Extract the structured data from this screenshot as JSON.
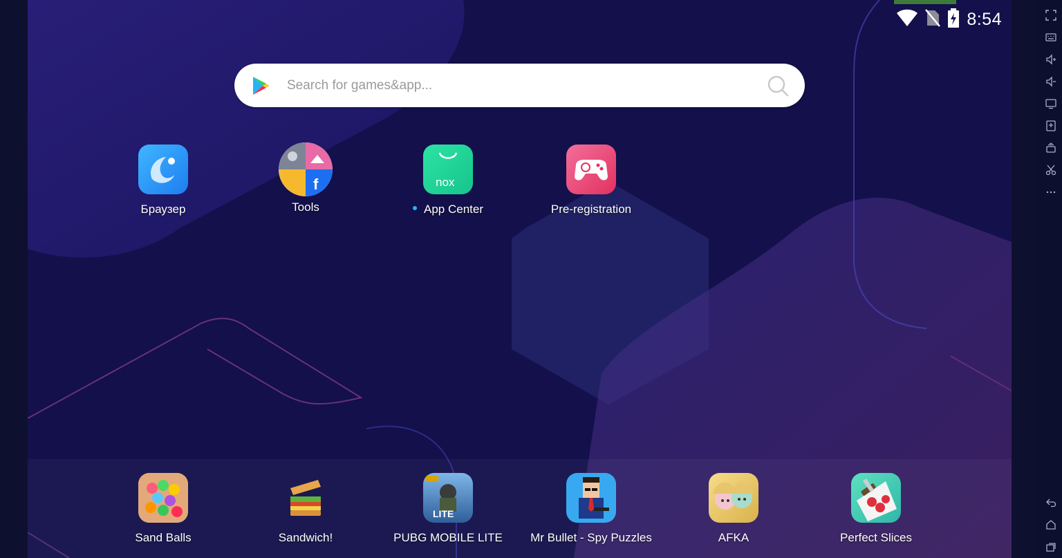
{
  "status_bar": {
    "time": "8:54",
    "icons": [
      "wifi-icon",
      "no-sim-icon",
      "battery-charging-icon"
    ]
  },
  "search": {
    "placeholder": "Search for games&app...",
    "value": ""
  },
  "home_apps": [
    {
      "label": "Браузер",
      "icon": "browser-icon"
    },
    {
      "label": "Tools",
      "icon": "tools-folder-icon"
    },
    {
      "label": "App Center",
      "icon": "nox-app-center-icon",
      "has_new_dot": true
    },
    {
      "label": "Pre-registration",
      "icon": "gamepad-icon"
    }
  ],
  "dock_apps": [
    {
      "label": "Sand Balls",
      "icon": "sand-balls-icon"
    },
    {
      "label": "Sandwich!",
      "icon": "sandwich-icon"
    },
    {
      "label": "PUBG MOBILE LITE",
      "icon": "pubg-lite-icon"
    },
    {
      "label": "Mr Bullet - Spy Puzzles",
      "icon": "mr-bullet-icon"
    },
    {
      "label": "AFKA",
      "icon": "afka-icon"
    },
    {
      "label": "Perfect Slices",
      "icon": "perfect-slices-icon"
    }
  ],
  "side_toolbar": [
    "fullscreen-icon",
    "keyboard-icon",
    "volume-up-icon",
    "volume-down-icon",
    "screen-icon",
    "add-apk-icon",
    "multi-instance-icon",
    "screenshot-cut-icon",
    "more-icon"
  ],
  "nav_buttons": [
    "back-icon",
    "home-icon",
    "recents-icon"
  ],
  "colors": {
    "wallpaper": "#12104a",
    "accent_dot": "#23b8f2",
    "notification_tab": "#3e7a3a"
  }
}
